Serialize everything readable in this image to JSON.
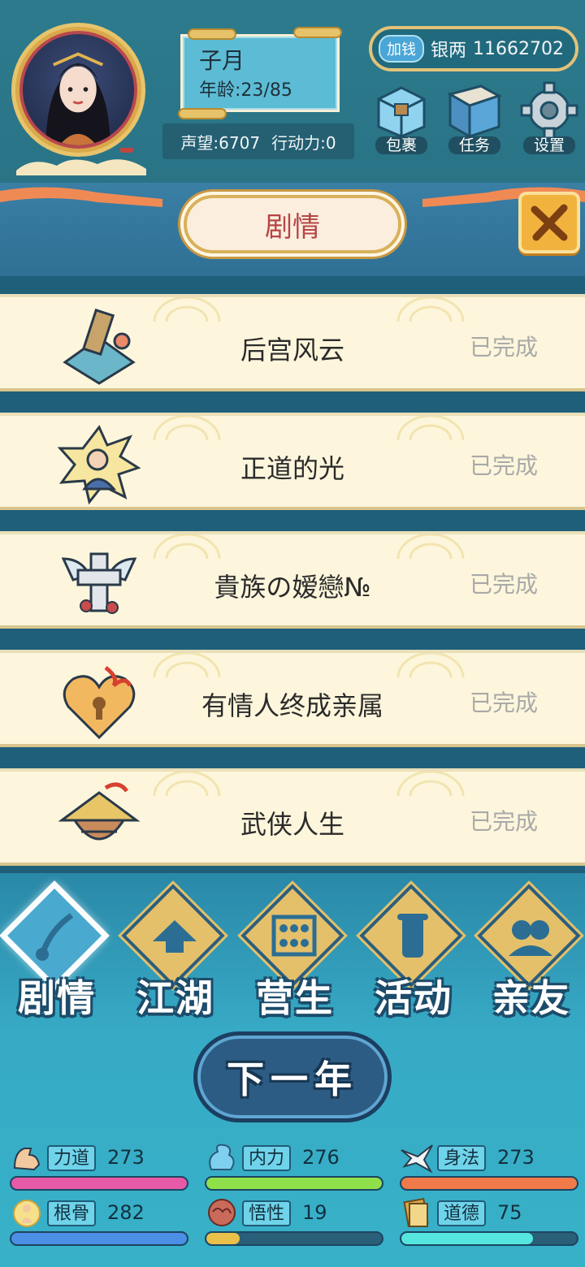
{
  "player": {
    "name": "子月",
    "age": "年龄:23/85",
    "reputation": "声望:6707",
    "action_points": "行动力:0"
  },
  "money": {
    "add_label": "加钱",
    "label": "银两",
    "value": "11662702"
  },
  "top_buttons": [
    {
      "label": "包裹",
      "icon": "bag-icon"
    },
    {
      "label": "任务",
      "icon": "book-icon"
    },
    {
      "label": "设置",
      "icon": "gear-icon"
    }
  ],
  "panel": {
    "title": "剧情",
    "close_icon": "close-icon"
  },
  "stories": [
    {
      "title": "后宫风云",
      "status": "已完成",
      "icon": "fan-icon"
    },
    {
      "title": "正道的光",
      "status": "已完成",
      "icon": "hero-icon"
    },
    {
      "title": "貴族の嫒戀№",
      "status": "已完成",
      "icon": "winged-cross-icon"
    },
    {
      "title": "有情人终成亲属",
      "status": "已完成",
      "icon": "heart-lock-icon"
    },
    {
      "title": "武侠人生",
      "status": "已完成",
      "icon": "straw-hat-icon"
    }
  ],
  "nav": [
    {
      "label": "剧情",
      "active": true
    },
    {
      "label": "江湖",
      "active": false
    },
    {
      "label": "营生",
      "active": false
    },
    {
      "label": "活动",
      "active": false
    },
    {
      "label": "亲友",
      "active": false
    }
  ],
  "next_year": "下一年",
  "attributes": [
    {
      "name": "力道",
      "value": "273",
      "fill": 1.0,
      "color": "#e65aa8"
    },
    {
      "name": "内力",
      "value": "276",
      "fill": 1.0,
      "color": "#8fe04b"
    },
    {
      "name": "身法",
      "value": "273",
      "fill": 1.0,
      "color": "#f07a4a"
    },
    {
      "name": "根骨",
      "value": "282",
      "fill": 1.0,
      "color": "#4c8fe6"
    },
    {
      "name": "悟性",
      "value": "19",
      "fill": 0.19,
      "color": "#e8c04a"
    },
    {
      "name": "道德",
      "value": "75",
      "fill": 0.75,
      "color": "#55e6e0"
    }
  ]
}
